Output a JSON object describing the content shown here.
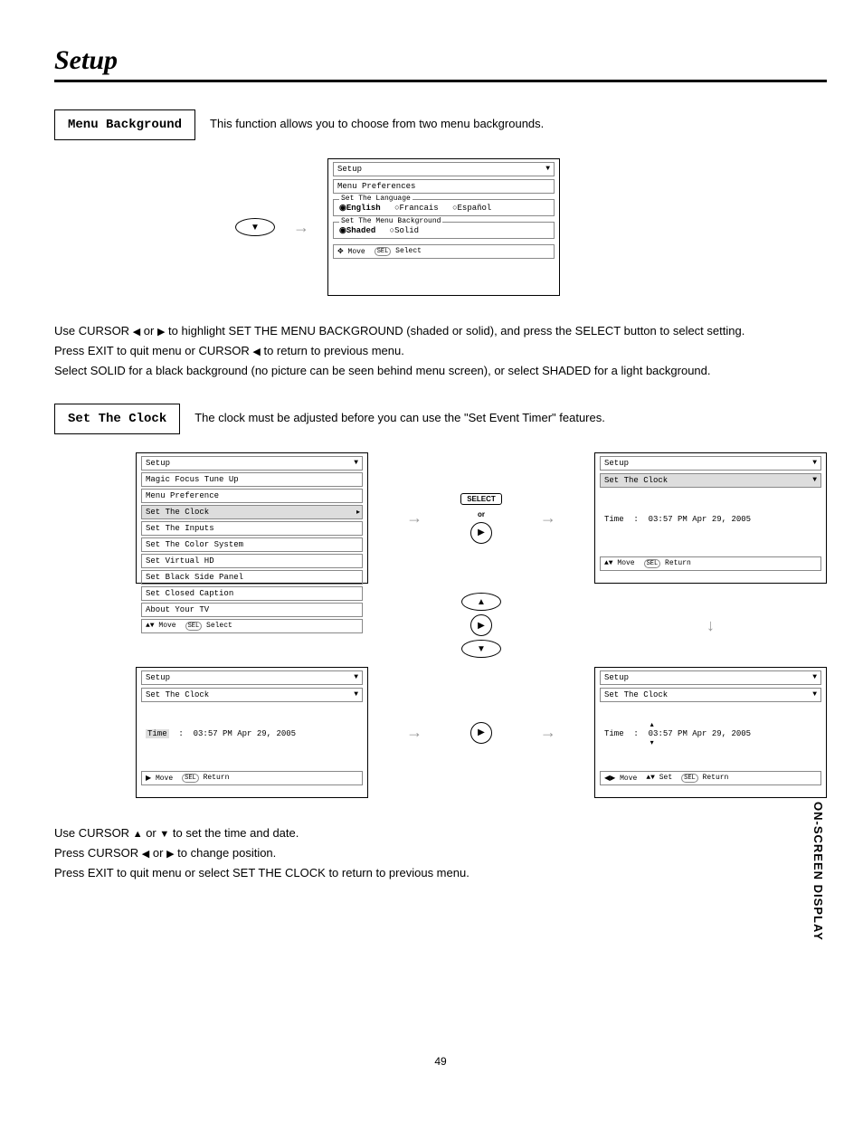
{
  "title": "Setup",
  "page_number": "49",
  "side_tab": "ON-SCREEN DISPLAY",
  "section_menu_bg": {
    "label": "Menu Background",
    "desc": "This function allows you to choose from two menu backgrounds.",
    "instr1_pre": "Use CURSOR ",
    "instr1_mid": " or ",
    "instr1_post": " to highlight SET THE MENU BACKGROUND (shaded or solid), and press the SELECT button to select setting.",
    "instr2_pre": "Press EXIT to quit menu or CURSOR ",
    "instr2_post": " to return to previous menu.",
    "instr3": "Select SOLID for a black background (no picture can be seen behind menu screen), or select SHADED for a light background."
  },
  "osd_pref": {
    "title": "Setup",
    "subtitle": "Menu Preferences",
    "lang_legend": "Set The Language",
    "lang_opts": [
      "English",
      "Francais",
      "Español"
    ],
    "bg_legend": "Set The Menu Background",
    "bg_opts": [
      "Shaded",
      "Solid"
    ],
    "footer_move": "Move",
    "footer_sel": "Select",
    "sel_btn": "SEL"
  },
  "section_clock": {
    "label": "Set The Clock",
    "desc": "The clock must be adjusted before you can use the \"Set Event Timer\"  features.",
    "instr1_pre": "Use CURSOR ",
    "instr1_mid": " or ",
    "instr1_post": " to set the time and date.",
    "instr2_pre": "Press CURSOR ",
    "instr2_mid": " or ",
    "instr2_post": " to change position.",
    "instr3": "Press EXIT to quit menu or select SET THE CLOCK to return to previous menu."
  },
  "osd_setup_list": {
    "title": "Setup",
    "items": [
      "Magic Focus Tune Up",
      "Menu Preference",
      "Set The Clock",
      "Set The Inputs",
      "Set The Color System",
      "Set Virtual HD",
      "Set Black Side Panel",
      "Set Closed Caption",
      "About Your TV"
    ],
    "footer_move": "Move",
    "footer_sel": "Select",
    "sel_btn": "SEL"
  },
  "osd_clock": {
    "title": "Setup",
    "subtitle": "Set The Clock",
    "time_label": "Time",
    "time_value": "03:57 PM Apr 29, 2005",
    "time_hour": "03",
    "time_rest": ":57 PM Apr 29, 2005",
    "footer_move": "Move",
    "footer_set": "Set",
    "footer_ret": "Return",
    "sel_btn": "SEL"
  },
  "controls": {
    "select_label": "SELECT",
    "or": "or"
  }
}
